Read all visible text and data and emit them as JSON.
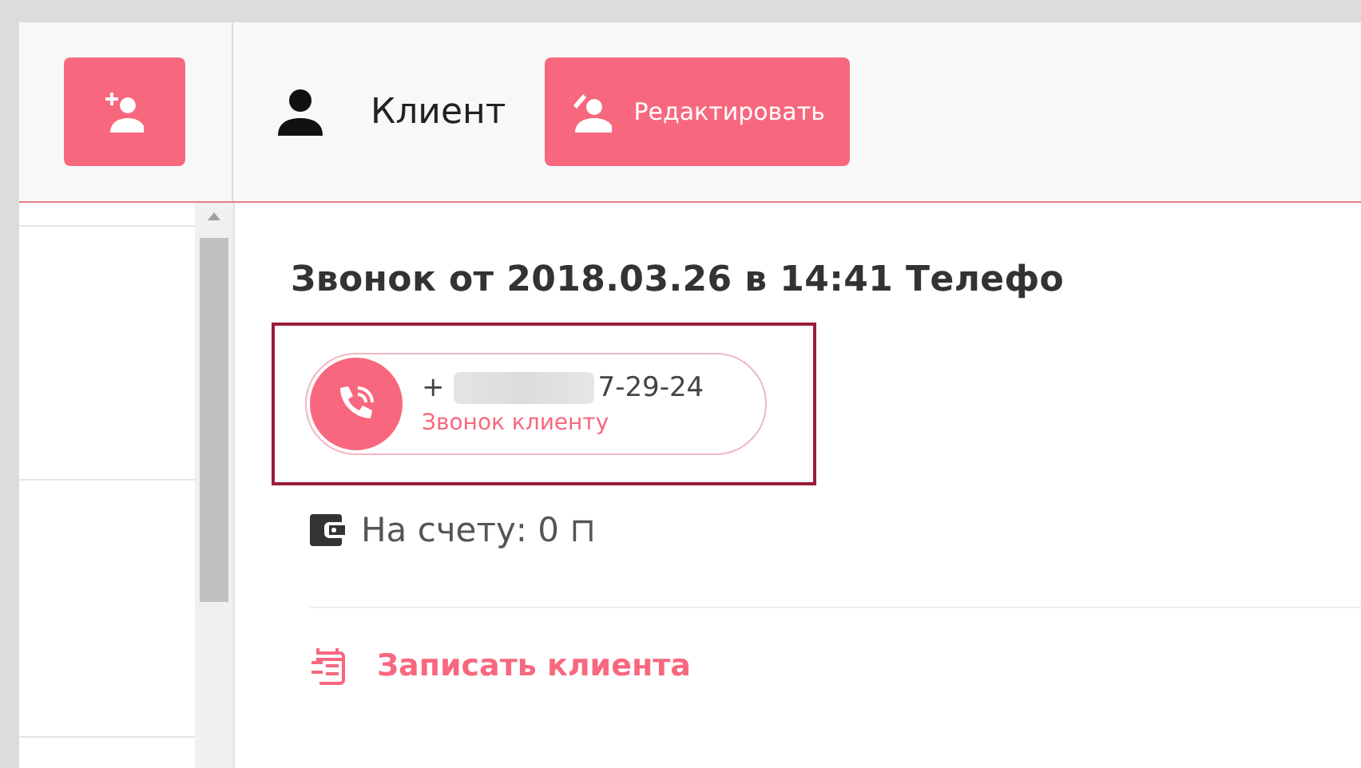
{
  "header": {
    "title": "Клиент",
    "edit_button": "Редактировать"
  },
  "call": {
    "title": "Звонок от 2018.03.26 в 14:41 Телефо",
    "phone_prefix": "+",
    "phone_suffix": "7-29-24",
    "phone_redacted": true,
    "phone_caption": "Звонок клиенту",
    "highlighted": true
  },
  "balance": "На счету: 0 ⊓",
  "book_link": "Записать клиента"
}
